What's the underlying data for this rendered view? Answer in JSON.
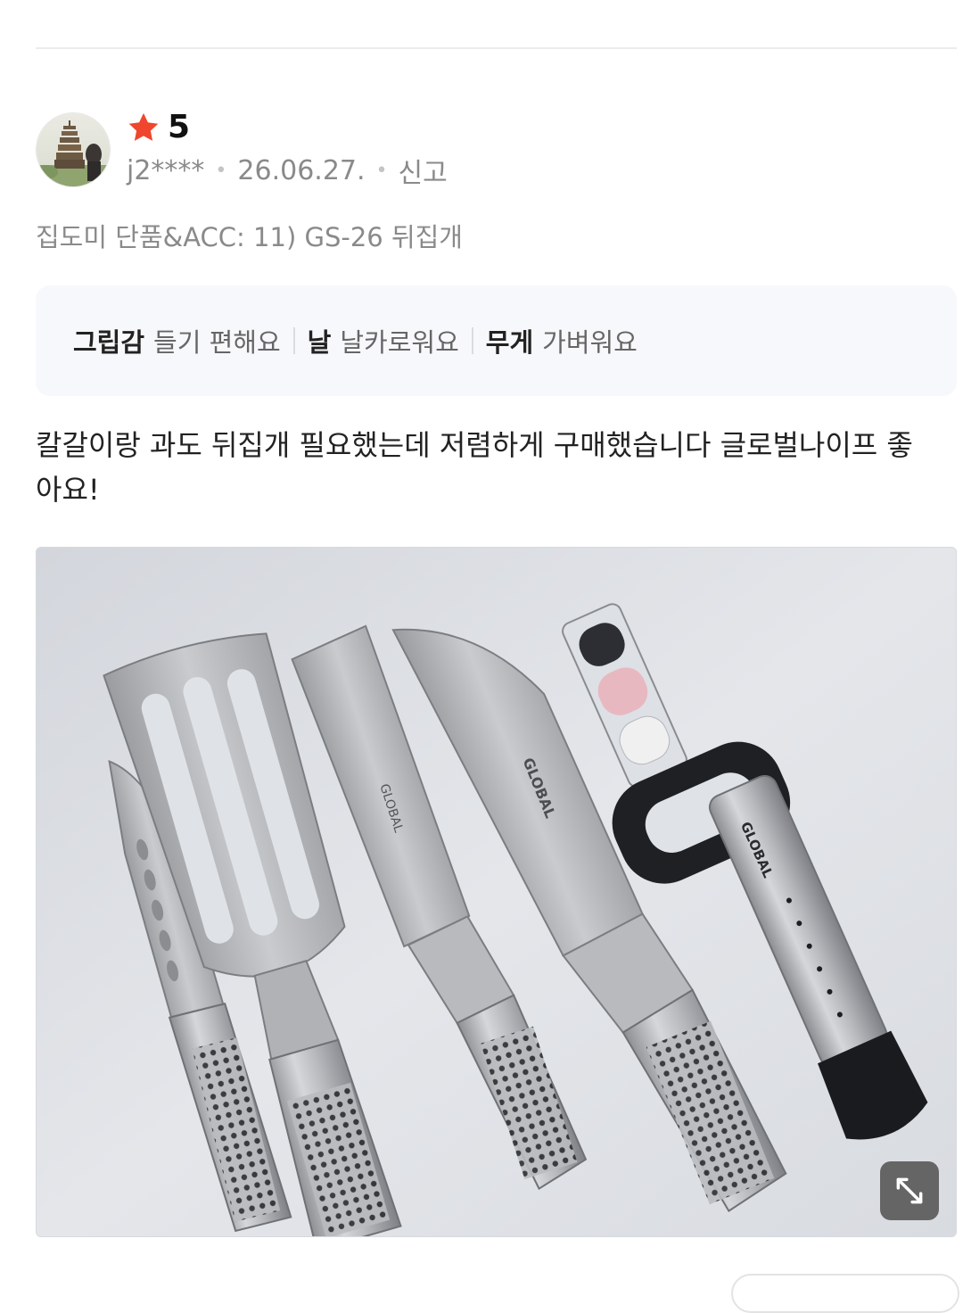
{
  "review": {
    "rating_value": "5",
    "user_id": "j2****",
    "date": "26.06.27.",
    "report_label": "신고",
    "option_text": "집도미 단품&ACC: 11) GS-26 뒤집개",
    "attributes": [
      {
        "key": "그립감",
        "value": "들기 편해요"
      },
      {
        "key": "날",
        "value": "날카로워요"
      },
      {
        "key": "무게",
        "value": "가벼워요"
      }
    ],
    "body_text": "칼갈이랑 과도 뒤집개 필요했는데 저렴하게 구매했습니다 글로벌나이프 좋아요!"
  },
  "icons": {
    "star": "star-icon",
    "expand": "expand-arrows-icon"
  },
  "colors": {
    "star": "#f0462e",
    "meta_text": "#8a8a8a",
    "attribute_box_bg": "#f7f8fb"
  }
}
